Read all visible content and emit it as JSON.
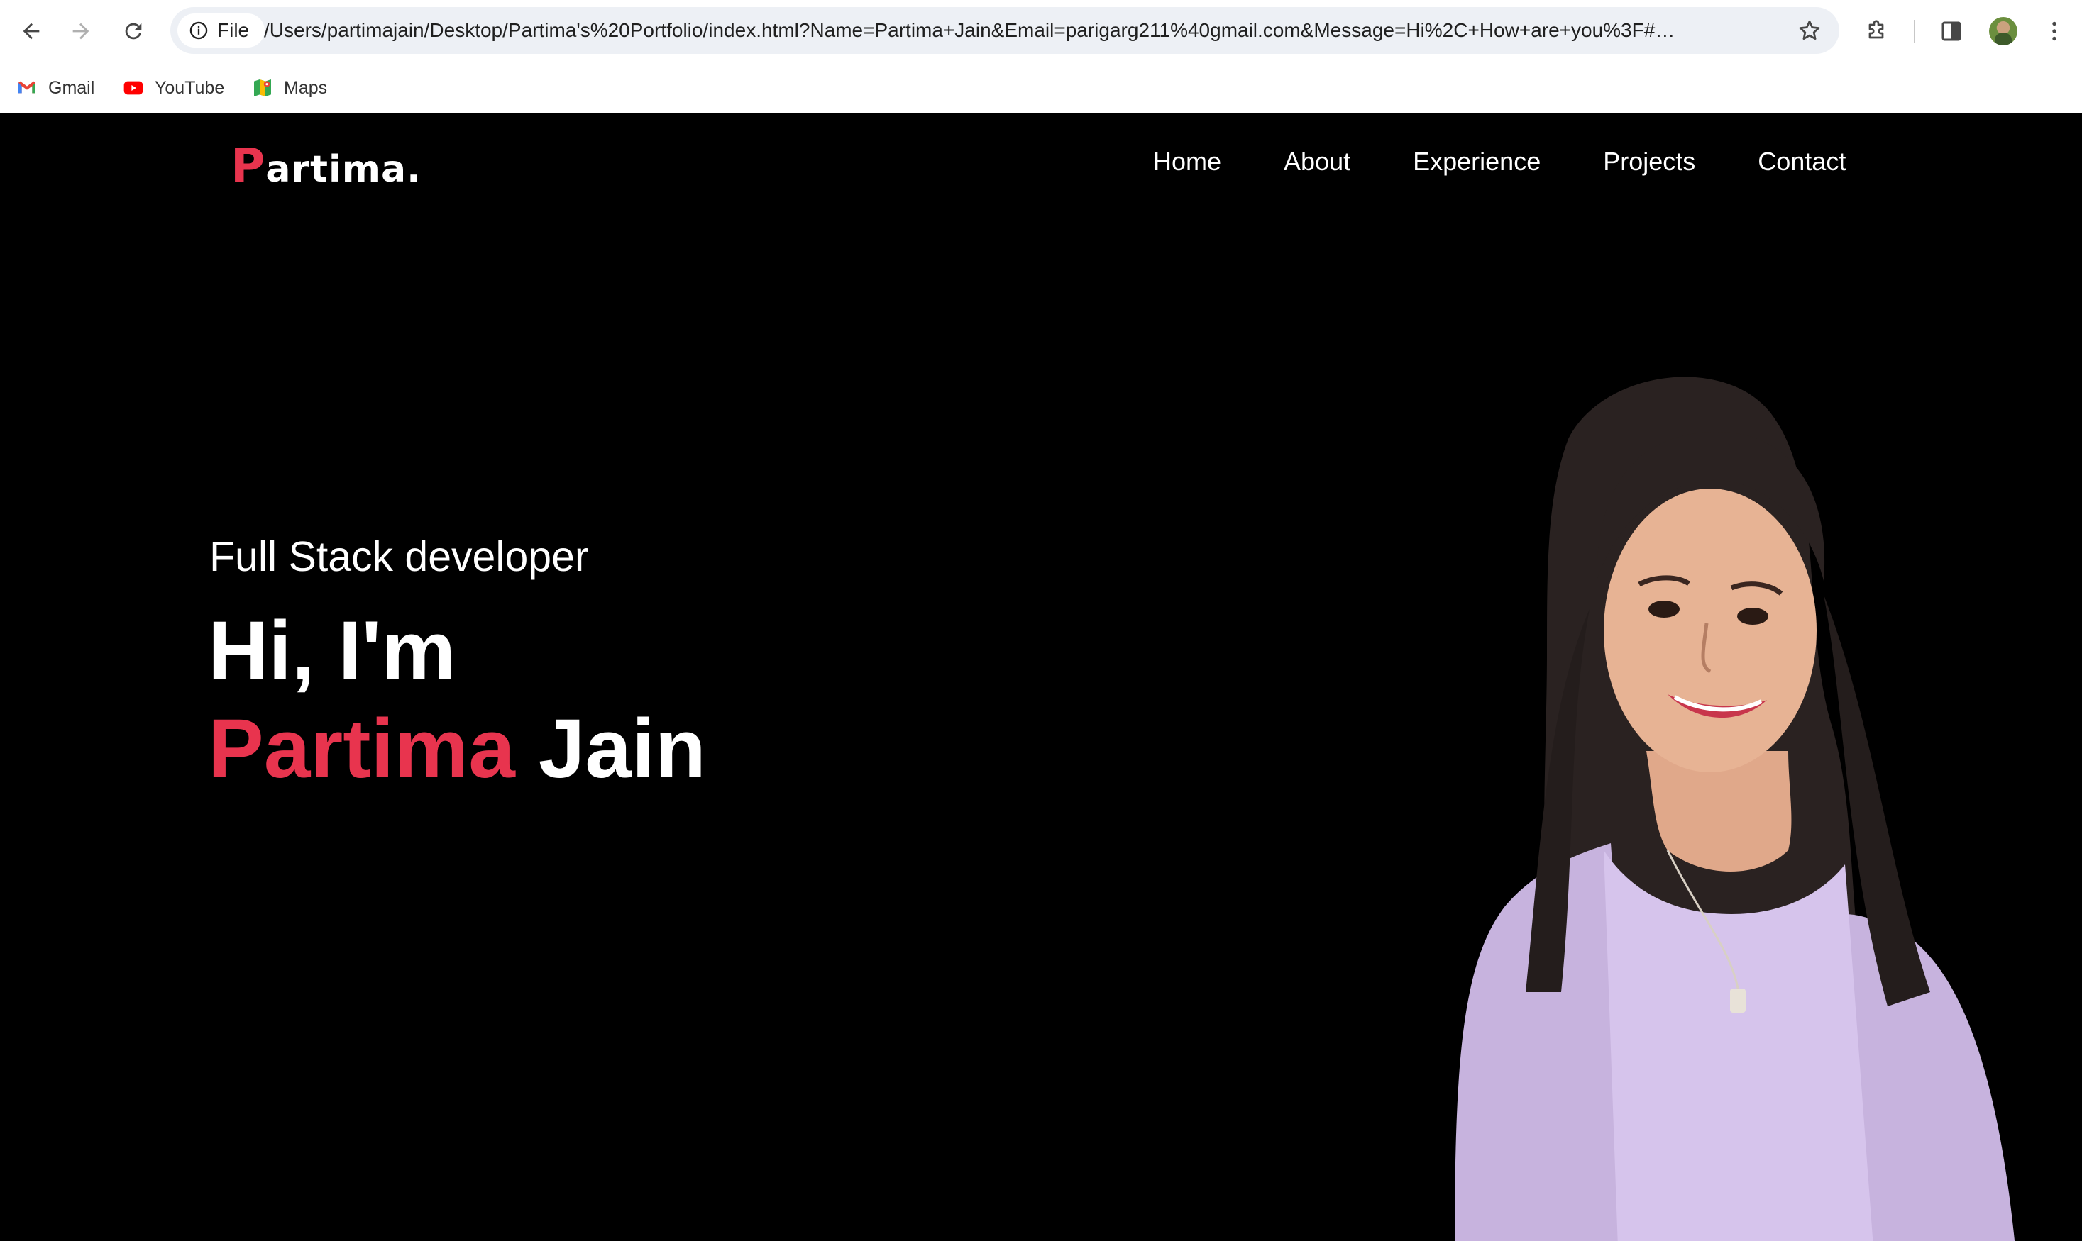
{
  "browser": {
    "file_chip_label": "File",
    "url": "/Users/partimajain/Desktop/Partima's%20Portfolio/index.html?Name=Partima+Jain&Email=parigarg211%40gmail.com&Message=Hi%2C+How+are+you%3F#con...",
    "bookmarks": [
      {
        "label": "Gmail",
        "icon": "gmail-icon"
      },
      {
        "label": "YouTube",
        "icon": "youtube-icon"
      },
      {
        "label": "Maps",
        "icon": "maps-icon"
      }
    ]
  },
  "site": {
    "logo_initial": "P",
    "logo_rest": "artima.",
    "nav": [
      "Home",
      "About",
      "Experience",
      "Projects",
      "Contact"
    ],
    "hero": {
      "subtitle": "Full Stack developer",
      "greeting": "Hi, I'm",
      "first_name": "Partima",
      "last_name": "Jain"
    }
  },
  "colors": {
    "accent": "#e8344e",
    "background": "#000000",
    "text": "#ffffff",
    "omnibox": "#edf0f5"
  }
}
